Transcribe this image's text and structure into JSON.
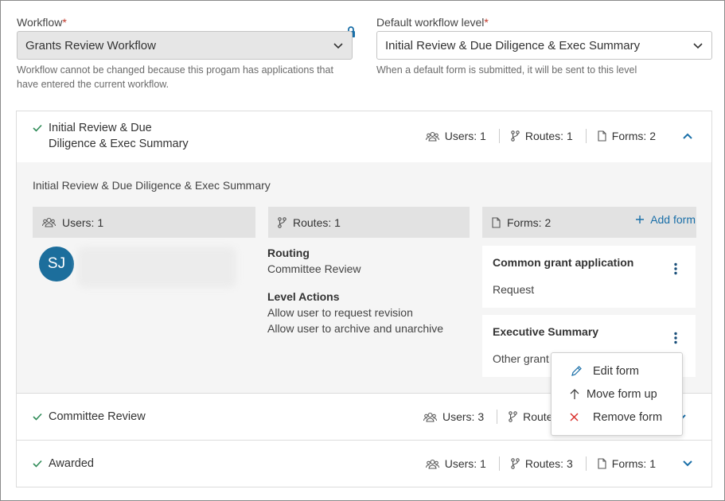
{
  "workflow": {
    "label": "Workflow",
    "required_mark": "*",
    "value": "Grants Review Workflow",
    "help": "Workflow cannot be changed because this progam has applications that have entered the current workflow."
  },
  "default_level": {
    "label": "Default workflow level",
    "required_mark": "*",
    "value": "Initial Review & Due Diligence & Exec Summary",
    "help": "When a default form is submitted, it will be sent to this level"
  },
  "levels": [
    {
      "title_line1": "Initial Review & Due",
      "title_line2": "Diligence & Exec Summary",
      "users": "Users: 1",
      "routes": "Routes: 1",
      "forms": "Forms: 2",
      "expanded": true,
      "body": {
        "title": "Initial Review & Due Diligence & Exec Summary",
        "users_head": "Users: 1",
        "routes_head": "Routes: 1",
        "forms_head": "Forms: 2",
        "add_form": "Add form",
        "avatar_initials": "SJ",
        "routing_heading": "Routing",
        "routing_value": "Committee Review",
        "actions_heading": "Level Actions",
        "actions": [
          "Allow user to request revision",
          "Allow user to archive and unarchive"
        ],
        "forms": [
          {
            "name": "Common grant application",
            "type": "Request"
          },
          {
            "name": "Executive Summary",
            "type": "Other grant"
          }
        ]
      }
    },
    {
      "title": "Committee Review",
      "users": "Users: 3",
      "routes": "Route"
    },
    {
      "title": "Awarded",
      "users": "Users: 1",
      "routes": "Routes: 3",
      "forms": "Forms: 1"
    }
  ],
  "menu": {
    "items": [
      "Edit form",
      "Move form up",
      "Remove form"
    ]
  },
  "colors": {
    "accent": "#1a6fa8",
    "check": "#2e8b57",
    "remove": "#d9302c",
    "avatar": "#1c6e9c"
  }
}
